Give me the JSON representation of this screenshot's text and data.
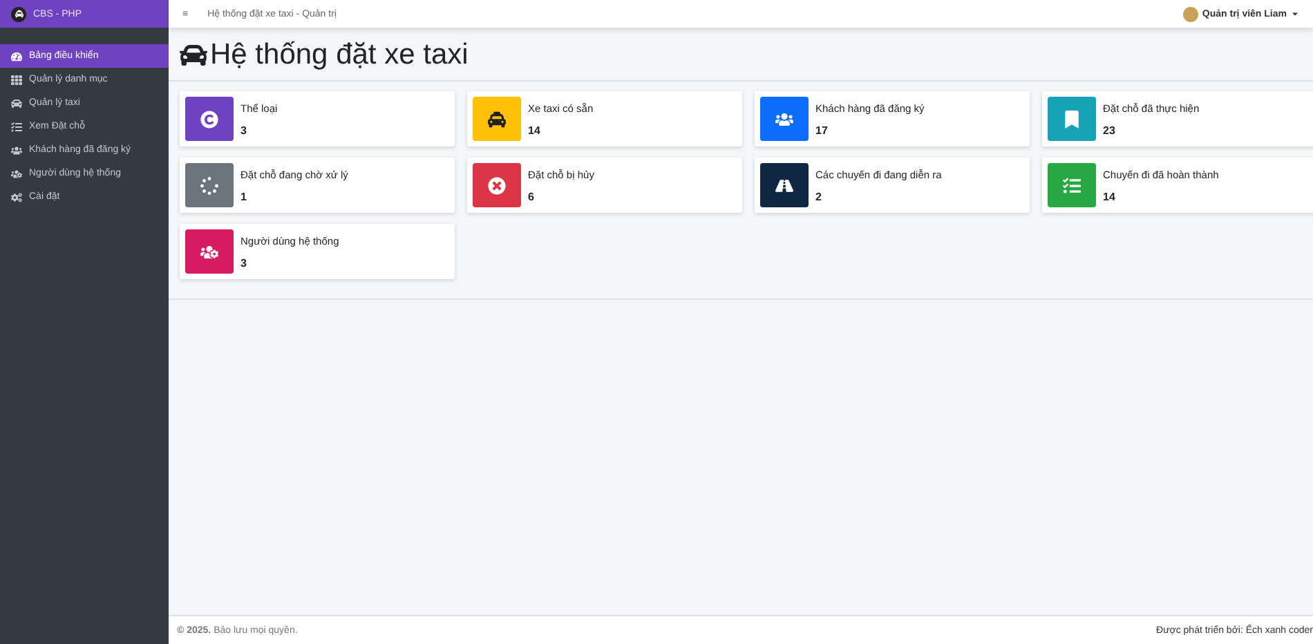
{
  "sidebar": {
    "brand": "CBS - PHP",
    "items": [
      {
        "label": "Bảng điều khiển",
        "selected": true
      },
      {
        "label": "Quản lý danh mục",
        "selected": false
      },
      {
        "label": "Quản lý taxi",
        "selected": false
      },
      {
        "label": "Xem Đặt chỗ",
        "selected": false
      },
      {
        "label": "Khách hàng đã đăng ký",
        "selected": false
      },
      {
        "label": "Người dùng hệ thống",
        "selected": false
      },
      {
        "label": "Cài đặt",
        "selected": false
      }
    ]
  },
  "topbar": {
    "menu_glyph": "≡",
    "breadcrumb": "Hệ thống đặt xe taxi - Quản trị",
    "user": "Quản trị viên Liam"
  },
  "page_title": "Hệ thống đặt xe taxi",
  "cards": [
    {
      "label": "Thể loại",
      "value": "3",
      "color": "#6f42c1"
    },
    {
      "label": "Xe taxi có sẵn",
      "value": "14",
      "color": "#ffc107"
    },
    {
      "label": "Khách hàng đã đăng ký",
      "value": "17",
      "color": "#0d6efd"
    },
    {
      "label": "Đặt chỗ đã thực hiện",
      "value": "23",
      "color": "#17a2b8"
    },
    {
      "label": "Đặt chỗ đang chờ xử lý",
      "value": "1",
      "color": "#6c757d"
    },
    {
      "label": "Đặt chỗ bị hủy",
      "value": "6",
      "color": "#dc3545"
    },
    {
      "label": "Các chuyến đi đang diễn ra",
      "value": "2",
      "color": "#0f2743"
    },
    {
      "label": "Chuyến đi đã hoàn thành",
      "value": "14",
      "color": "#28a745"
    },
    {
      "label": "Người dùng hệ thống",
      "value": "3",
      "color": "#d81b60"
    }
  ],
  "footer": {
    "left": "**© 2025.** Bảo lưu mọi quyền.",
    "right": "Được phát triển bởi: Ếch xanh coder"
  }
}
